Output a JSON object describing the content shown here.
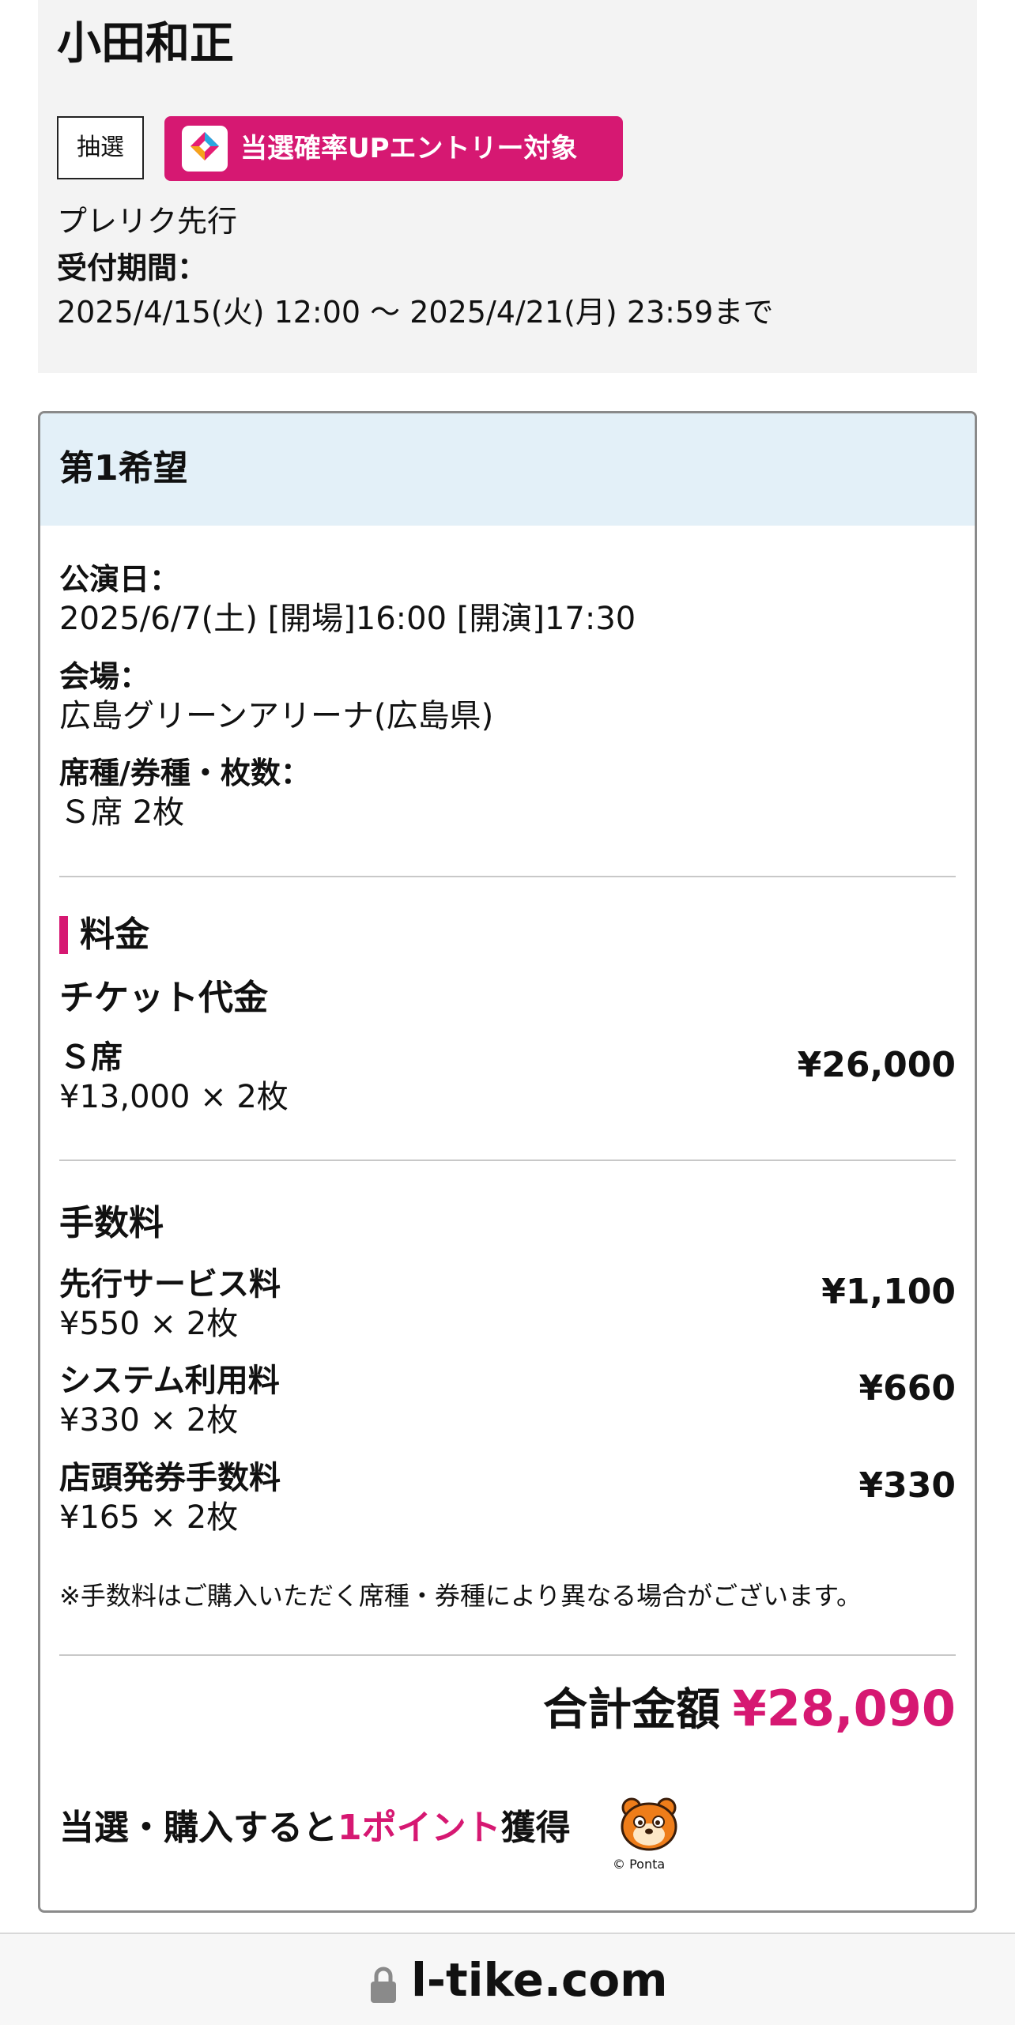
{
  "event": {
    "artist": "小田和正",
    "lottery_tag": "抽選",
    "entry_tag": "当選確率UPエントリー対象",
    "sale_name": "プレリク先行",
    "period_label": "受付期間：",
    "period_value": "2025/4/15(火) 12:00 〜 2025/4/21(月) 23:59まで"
  },
  "wish": {
    "title": "第1希望",
    "date_label": "公演日：",
    "date_value": "2025/6/7(土) [開場]16:00 [開演]17:30",
    "venue_label": "会場：",
    "venue_value": "広島グリーンアリーナ(広島県)",
    "seat_label": "席種/券種・枚数：",
    "seat_value": "Ｓ席 2枚"
  },
  "pricing": {
    "section_title": "料金",
    "ticket_heading": "チケット代金",
    "ticket": {
      "name": "Ｓ席",
      "detail": "¥13,000 × 2枚",
      "amount": "¥26,000"
    },
    "fees_heading": "手数料",
    "fees": [
      {
        "name": "先行サービス料",
        "detail": "¥550 × 2枚",
        "amount": "¥1,100"
      },
      {
        "name": "システム利用料",
        "detail": "¥330 × 2枚",
        "amount": "¥660"
      },
      {
        "name": "店頭発券手数料",
        "detail": "¥165 × 2枚",
        "amount": "¥330"
      }
    ],
    "note": "※手数料はご購入いただく席種・券種により異なる場合がございます。",
    "total_label": "合計金額",
    "total_value": "¥28,090"
  },
  "points": {
    "prefix": "当選・購入すると",
    "highlight": "1ポイント",
    "suffix": "獲得",
    "mascot_icon": "ponta-mascot-icon",
    "copyright": "© Ponta"
  },
  "browser": {
    "domain": "l-tike.com",
    "icon": "lock-icon"
  },
  "colors": {
    "accent": "#d61872",
    "header_bg": "#e3f0f8",
    "card_bg": "#f3f3f3"
  }
}
